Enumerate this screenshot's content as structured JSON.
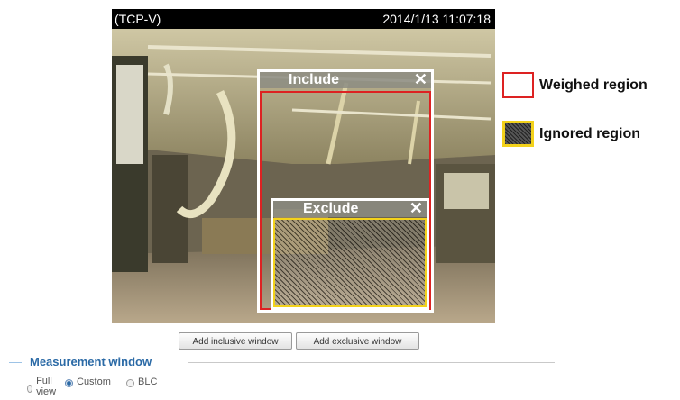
{
  "camera": {
    "source_label": "(TCP-V)",
    "timestamp": "2014/1/13 11:07:18"
  },
  "windows": {
    "include_label": "Include",
    "exclude_label": "Exclude",
    "close_glyph": "✕"
  },
  "legend": {
    "weighed_label": "Weighed region",
    "ignored_label": "Ignored region",
    "weighed_color": "#dd2222",
    "ignored_color": "#f3d21b"
  },
  "buttons": {
    "add_inclusive": "Add inclusive window",
    "add_exclusive": "Add exclusive window"
  },
  "measurement": {
    "title": "Measurement window",
    "options": [
      {
        "label": "Full view",
        "selected": false
      },
      {
        "label": "Custom",
        "selected": true
      },
      {
        "label": "BLC",
        "selected": false
      }
    ]
  }
}
